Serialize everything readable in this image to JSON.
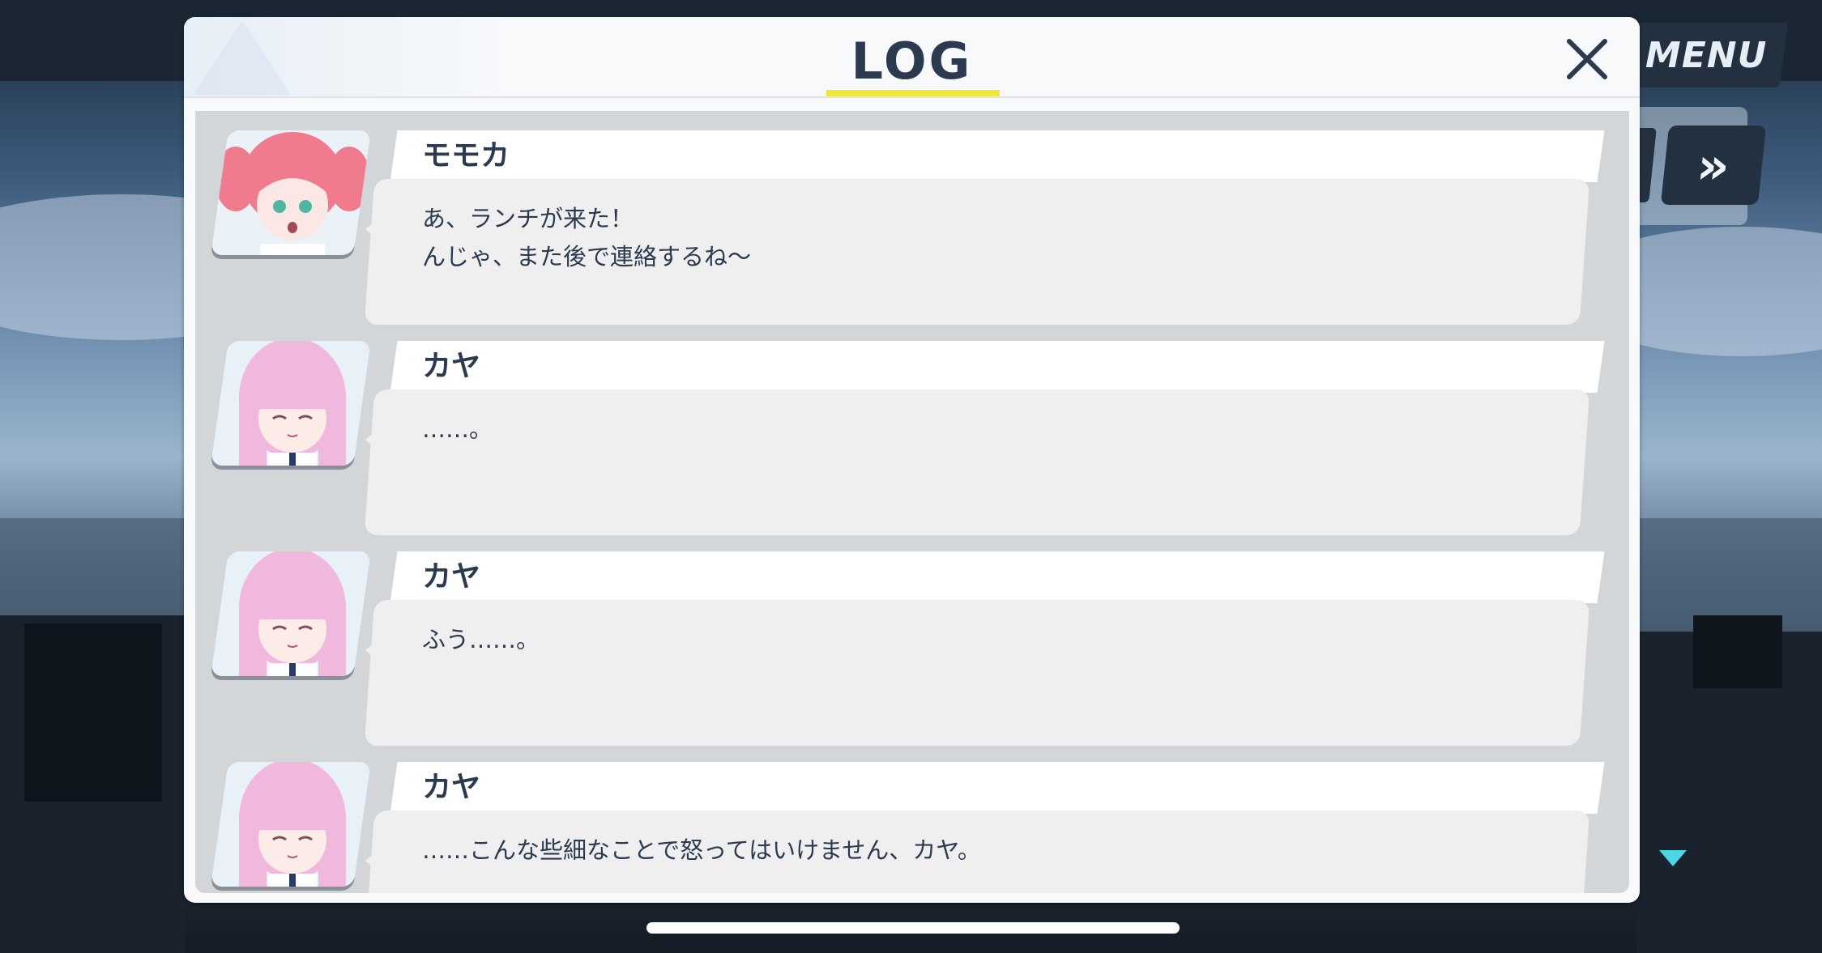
{
  "header": {
    "title": "LOG"
  },
  "hud": {
    "menu_label": "MENU",
    "auto_label": "»"
  },
  "entries": [
    {
      "speaker": "モモカ",
      "text": "あ、ランチが来た！\nんじゃ、また後で連絡するね〜",
      "portrait": "momoka-portrait"
    },
    {
      "speaker": "カヤ",
      "text": "……。",
      "portrait": "kaya-portrait"
    },
    {
      "speaker": "カヤ",
      "text": "ふう……。",
      "portrait": "kaya-portrait"
    },
    {
      "speaker": "カヤ",
      "text": "……こんな些細なことで怒ってはいけません、カヤ。",
      "portrait": "kaya-portrait"
    }
  ],
  "colors": {
    "accent_underline": "#f2e53a",
    "title_text": "#2b3a4f",
    "momoka_hair": "#f07a8e",
    "kaya_hair": "#f0b8dc"
  }
}
